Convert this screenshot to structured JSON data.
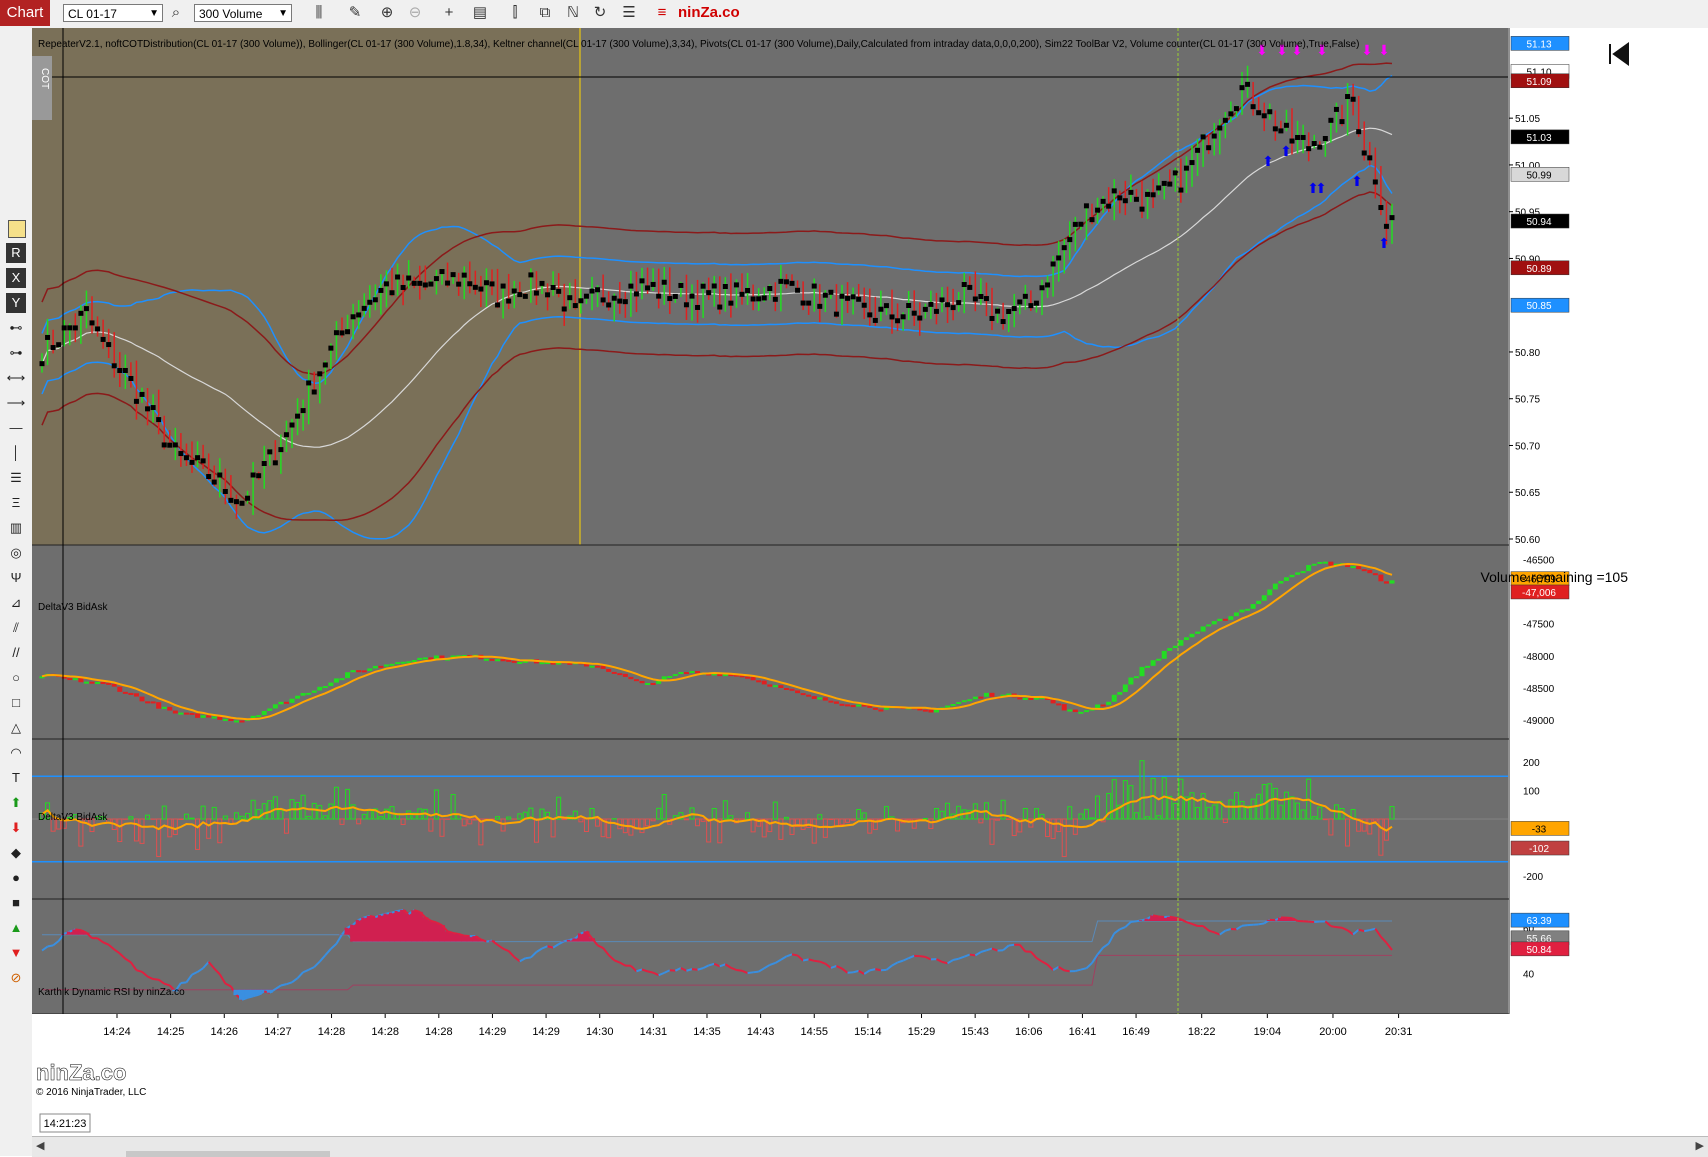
{
  "toolbar": {
    "chart_button": "Chart",
    "instrument": "CL 01-17",
    "period": "300 Volume",
    "brand": "ninZa.co"
  },
  "panel1": {
    "indicator_line": "RepeaterV2.1, noftCOTDistribution(CL 01-17 (300 Volume)), Bollinger(CL 01-17 (300 Volume),1.8,34), Keltner channel(CL 01-17 (300 Volume),3,34), Pivots(CL 01-17 (300 Volume),Daily,Calculated from intraday data,0,0,0,200), Sim22 ToolBar V2, Volume counter(CL 01-17 (300 Volume),True,False)",
    "cot_tab": "COT",
    "volume_remaining": "Volume remaining =105",
    "price_ticks": [
      "51.05",
      "51.00",
      "50.95",
      "50.90",
      "50.80",
      "50.75",
      "50.70",
      "50.65",
      "50.60"
    ],
    "price_markers": [
      {
        "label": "51.13",
        "bg": "#1e90ff",
        "fg": "#ffffff",
        "v": 51.13
      },
      {
        "label": "51.10",
        "bg": "#ffffff",
        "fg": "#000000",
        "v": 51.1
      },
      {
        "label": "51.09",
        "bg": "#a01010",
        "fg": "#ffffff",
        "v": 51.09
      },
      {
        "label": "51.03",
        "bg": "#000000",
        "fg": "#ffffff",
        "v": 51.03
      },
      {
        "label": "50.99",
        "bg": "#d8d8d8",
        "fg": "#000000",
        "v": 50.99
      },
      {
        "label": "50.94",
        "bg": "#000000",
        "fg": "#ffffff",
        "v": 50.94
      },
      {
        "label": "50.89",
        "bg": "#a01010",
        "fg": "#ffffff",
        "v": 50.89
      },
      {
        "label": "50.85",
        "bg": "#1e90ff",
        "fg": "#ffffff",
        "v": 50.85
      }
    ]
  },
  "panel2": {
    "title": "DeltaV3 BidAsk",
    "ticks": [
      "-46500",
      "-47500",
      "-48000",
      "-48500",
      "-49000"
    ],
    "markers": [
      {
        "label": "-46,799",
        "bg": "#ffa500",
        "fg": "#000000",
        "v": -46799
      },
      {
        "label": "-47,006",
        "bg": "#e02020",
        "fg": "#ffffff",
        "v": -47006
      }
    ]
  },
  "panel3": {
    "title": "DeltaV3 BidAsk",
    "ticks": [
      "200",
      "100",
      "-200"
    ],
    "markers": [
      {
        "label": "-33",
        "bg": "#ffa500",
        "fg": "#000000",
        "v": -33
      },
      {
        "label": "-102",
        "bg": "#c04040",
        "fg": "#ffffff",
        "v": -102
      }
    ]
  },
  "panel4": {
    "title": "Karthik Dynamic RSI by ninZa.co",
    "ticks": [
      "60",
      "40"
    ],
    "markers": [
      {
        "label": "63.39",
        "bg": "#1e90ff",
        "fg": "#ffffff",
        "v": 63.39
      },
      {
        "label": "55.66",
        "bg": "#808080",
        "fg": "#ffffff",
        "v": 55.66
      },
      {
        "label": "50.84",
        "bg": "#e02040",
        "fg": "#ffffff",
        "v": 50.84
      }
    ],
    "logo": "ninZa.co",
    "copyright": "© 2016 NinjaTrader, LLC"
  },
  "time_axis": {
    "current": "14:21:23",
    "labels": [
      "14:24",
      "14:25",
      "14:26",
      "14:27",
      "14:28",
      "14:28",
      "14:28",
      "14:29",
      "14:29",
      "14:30",
      "14:31",
      "14:35",
      "14:43",
      "14:55",
      "15:14",
      "15:29",
      "15:43",
      "16:06",
      "16:41",
      "16:49",
      "18:22",
      "19:04",
      "20:00",
      "20:31"
    ]
  },
  "chart_data": {
    "type": "candlestick",
    "instrument": "CL 01-17",
    "period": "300 Volume",
    "close_anchors": [
      [
        0,
        50.8
      ],
      [
        8,
        50.84
      ],
      [
        12,
        50.8
      ],
      [
        18,
        50.75
      ],
      [
        24,
        50.69
      ],
      [
        30,
        50.67
      ],
      [
        36,
        50.64
      ],
      [
        44,
        50.71
      ],
      [
        50,
        50.78
      ],
      [
        56,
        50.84
      ],
      [
        62,
        50.87
      ],
      [
        68,
        50.87
      ],
      [
        76,
        50.88
      ],
      [
        82,
        50.86
      ],
      [
        86,
        50.87
      ],
      [
        92,
        50.87
      ],
      [
        96,
        50.84
      ],
      [
        100,
        50.86
      ],
      [
        108,
        50.87
      ],
      [
        116,
        50.86
      ],
      [
        126,
        50.86
      ],
      [
        134,
        50.87
      ],
      [
        144,
        50.85
      ],
      [
        150,
        50.84
      ],
      [
        158,
        50.84
      ],
      [
        166,
        50.86
      ],
      [
        172,
        50.84
      ],
      [
        178,
        50.85
      ],
      [
        184,
        50.91
      ],
      [
        188,
        50.95
      ],
      [
        194,
        50.97
      ],
      [
        200,
        50.96
      ],
      [
        206,
        50.99
      ],
      [
        212,
        51.05
      ],
      [
        216,
        51.08
      ],
      [
        220,
        51.06
      ],
      [
        224,
        51.03
      ],
      [
        228,
        51.02
      ],
      [
        232,
        51.04
      ],
      [
        236,
        51.07
      ],
      [
        238,
        51.02
      ],
      [
        240,
        50.99
      ],
      [
        242,
        50.94
      ]
    ],
    "delta_cumulative_anchors": [
      [
        0,
        -48300
      ],
      [
        12,
        -48450
      ],
      [
        24,
        -48900
      ],
      [
        36,
        -49000
      ],
      [
        44,
        -48700
      ],
      [
        56,
        -48250
      ],
      [
        66,
        -48050
      ],
      [
        76,
        -48000
      ],
      [
        90,
        -48100
      ],
      [
        100,
        -48150
      ],
      [
        108,
        -48450
      ],
      [
        116,
        -48250
      ],
      [
        126,
        -48300
      ],
      [
        138,
        -48650
      ],
      [
        150,
        -48800
      ],
      [
        160,
        -48850
      ],
      [
        170,
        -48600
      ],
      [
        180,
        -48650
      ],
      [
        186,
        -48900
      ],
      [
        192,
        -48700
      ],
      [
        198,
        -48200
      ],
      [
        206,
        -47700
      ],
      [
        212,
        -47450
      ],
      [
        218,
        -47200
      ],
      [
        224,
        -46750
      ],
      [
        230,
        -46550
      ],
      [
        236,
        -46600
      ],
      [
        242,
        -46850
      ]
    ],
    "rsi_anchors": [
      [
        0,
        50
      ],
      [
        6,
        60
      ],
      [
        12,
        53
      ],
      [
        18,
        40
      ],
      [
        24,
        33
      ],
      [
        30,
        45
      ],
      [
        36,
        28
      ],
      [
        44,
        35
      ],
      [
        50,
        45
      ],
      [
        56,
        62
      ],
      [
        62,
        67
      ],
      [
        68,
        67
      ],
      [
        74,
        58
      ],
      [
        80,
        55
      ],
      [
        86,
        46
      ],
      [
        92,
        52
      ],
      [
        98,
        58
      ],
      [
        104,
        44
      ],
      [
        110,
        40
      ],
      [
        116,
        42
      ],
      [
        122,
        44
      ],
      [
        128,
        40
      ],
      [
        134,
        48
      ],
      [
        140,
        45
      ],
      [
        146,
        40
      ],
      [
        152,
        42
      ],
      [
        158,
        48
      ],
      [
        164,
        45
      ],
      [
        170,
        50
      ],
      [
        176,
        52
      ],
      [
        182,
        42
      ],
      [
        188,
        42
      ],
      [
        194,
        60
      ],
      [
        200,
        66
      ],
      [
        206,
        63
      ],
      [
        212,
        58
      ],
      [
        218,
        62
      ],
      [
        224,
        64
      ],
      [
        230,
        63
      ],
      [
        236,
        58
      ],
      [
        240,
        60
      ],
      [
        243,
        50
      ]
    ],
    "y_range_price": [
      50.6,
      51.14
    ],
    "y_range_delta_cum": [
      -49200,
      -46400
    ],
    "y_range_delta_bar": [
      -260,
      260
    ],
    "y_range_rsi": [
      25,
      70
    ]
  }
}
